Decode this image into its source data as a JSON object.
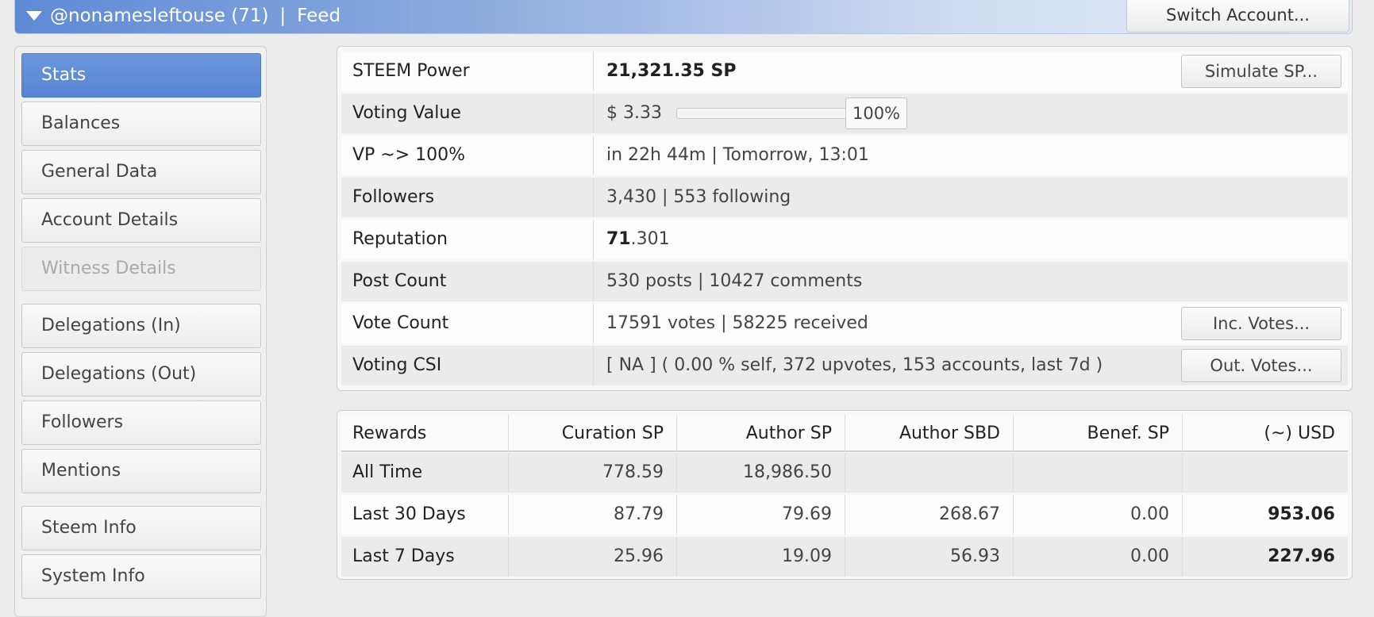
{
  "header": {
    "account": "@nonamesleftouse (71)",
    "separator": "|",
    "section": "Feed",
    "switch_label": "Switch Account..."
  },
  "sidebar": {
    "items": [
      {
        "label": "Stats",
        "active": true
      },
      {
        "label": "Balances"
      },
      {
        "label": "General Data"
      },
      {
        "label": "Account Details"
      },
      {
        "label": "Witness Details",
        "disabled": true
      },
      {
        "label": "Delegations (In)"
      },
      {
        "label": "Delegations (Out)"
      },
      {
        "label": "Followers"
      },
      {
        "label": "Mentions"
      },
      {
        "label": "Steem Info"
      },
      {
        "label": "System Info"
      }
    ]
  },
  "stats": {
    "steem_power": {
      "label": "STEEM Power",
      "value": "21,321.35 SP",
      "button": "Simulate SP..."
    },
    "voting_value": {
      "label": "Voting Value",
      "value": "$ 3.33",
      "slider_percent": "100%",
      "slider_fraction": 1.0
    },
    "vp": {
      "label": "VP ~> 100%",
      "value": "in 22h 44m | Tomorrow, 13:01"
    },
    "followers": {
      "label": "Followers",
      "value": "3,430 | 553 following"
    },
    "reputation": {
      "label": "Reputation",
      "value_int": "71",
      "value_dec": ".301"
    },
    "post_count": {
      "label": "Post Count",
      "value": "530 posts | 10427 comments"
    },
    "vote_count": {
      "label": "Vote Count",
      "value": "17591 votes | 58225 received",
      "button": "Inc. Votes..."
    },
    "voting_csi": {
      "label": "Voting CSI",
      "value": "[ NA ] ( 0.00 % self, 372 upvotes, 153 accounts, last 7d )",
      "button": "Out. Votes..."
    }
  },
  "rewards": {
    "headers": [
      "Rewards",
      "Curation SP",
      "Author SP",
      "Author SBD",
      "Benef. SP",
      "(~) USD"
    ],
    "rows": [
      {
        "period": "All Time",
        "curation": "778.59",
        "author_sp": "18,986.50",
        "author_sbd": "",
        "benef": "",
        "usd": ""
      },
      {
        "period": "Last 30 Days",
        "curation": "87.79",
        "author_sp": "79.69",
        "author_sbd": "268.67",
        "benef": "0.00",
        "usd": "953.06"
      },
      {
        "period": "Last 7 Days",
        "curation": "25.96",
        "author_sp": "19.09",
        "author_sbd": "56.93",
        "benef": "0.00",
        "usd": "227.96"
      }
    ]
  }
}
